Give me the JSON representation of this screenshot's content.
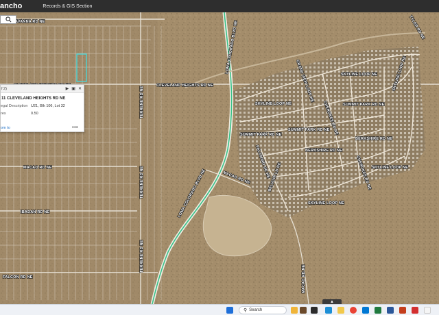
{
  "header": {
    "brand": "ancho",
    "nav_link": "Records & GIS Section"
  },
  "map": {
    "road_labels": [
      "AVANNA RD NE",
      "CLEVELAND HEIGHTS RD NE",
      "CLEVELAND HEIGHTS RD NE",
      "LOMA COLORADO BLVD NE",
      "LOMA COLORADO BLVD NE",
      "TERRENE RD NE",
      "TERRENE RD NE",
      "TERRENE RD NE",
      "MACAO RD NE",
      "MACAO RD NE",
      "MACAO RD NE",
      "IBADAN RD NE",
      "FALCON RD NE",
      "SKYLINE LOOP NE",
      "SKYLINE LOOP NE",
      "SKYLINE LOOP NE",
      "SKYLINE LOOP NE",
      "SKYLINE LOOP NE",
      "SUMMIT PARK RD NE",
      "SUMMIT PARK RD NE",
      "SUMMIT PARK RD NE",
      "BERKSHIRE RD NE",
      "BERKSHIRE RD NE",
      "GRAND VIEW LOOP NE",
      "CHEROKEE RD NE",
      "CHEROKEE RD NE",
      "PALOMINO DR NE",
      "TYLER RD NE",
      "BELVOIR LN NE"
    ]
  },
  "popup": {
    "count": "f 2)",
    "title": "11 CLEVELAND HEIGHTS RD NE",
    "rows": [
      {
        "key": "egal Description",
        "value": "U21, Blk 106, Lot 32"
      },
      {
        "key": "res",
        "value": "0.50"
      }
    ],
    "zoom_link": "om to",
    "more": "•••"
  },
  "taskbar": {
    "search_label": "Search"
  },
  "colors": {
    "header_bg": "#2e2e2e",
    "terrain": "#a08a68",
    "road_highlight": "#39c28a",
    "selected_parcel": "#3fe0e6"
  }
}
